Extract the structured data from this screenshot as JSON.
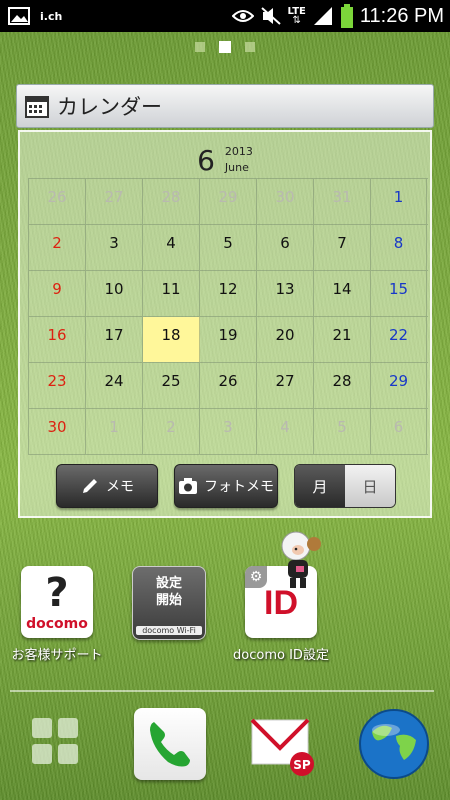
{
  "status_bar": {
    "carrier_text": "i.ch",
    "network_label": "LTE",
    "time": "11:26 PM",
    "icons": [
      "gallery-icon",
      "eye-icon",
      "silent-icon",
      "lte-data-icon",
      "signal-icon",
      "battery-icon"
    ]
  },
  "home": {
    "page_count": 3,
    "active_page": 2
  },
  "calendar": {
    "title": "カレンダー",
    "month_number": "6",
    "year": "2013",
    "month_name": "June",
    "weeks": [
      [
        "26",
        "27",
        "28",
        "29",
        "30",
        "31",
        "1"
      ],
      [
        "2",
        "3",
        "4",
        "5",
        "6",
        "7",
        "8"
      ],
      [
        "9",
        "10",
        "11",
        "12",
        "13",
        "14",
        "15"
      ],
      [
        "16",
        "17",
        "18",
        "19",
        "20",
        "21",
        "22"
      ],
      [
        "23",
        "24",
        "25",
        "26",
        "27",
        "28",
        "29"
      ],
      [
        "30",
        "1",
        "2",
        "3",
        "4",
        "5",
        "6"
      ]
    ],
    "today": "18",
    "buttons": {
      "memo": "メモ",
      "photo_memo": "フォトメモ",
      "month": "月",
      "day": "日"
    }
  },
  "apps": [
    {
      "label": "お客様サポート",
      "icon": "docomo-support-icon",
      "tile_text": "docomo"
    },
    {
      "label": "",
      "icon": "docomo-wifi-setup-icon",
      "tile_line1": "設定",
      "tile_line2": "開始",
      "tile_footer": "docomo Wi-Fi"
    },
    {
      "label": "docomo ID設定",
      "icon": "docomo-id-icon",
      "tile_text": "ID"
    }
  ],
  "dock": [
    "app-drawer-icon",
    "phone-icon",
    "mail-icon",
    "browser-globe-icon"
  ],
  "colors": {
    "sunday": "#d21",
    "saturday": "#1838c8",
    "today_highlight": "#fff79a"
  }
}
